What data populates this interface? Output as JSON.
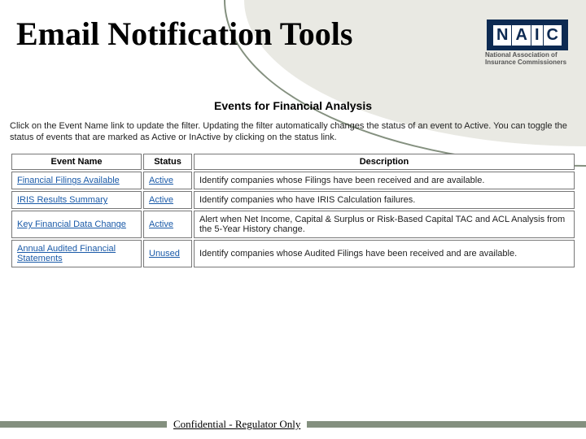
{
  "title": "Email Notification Tools",
  "logo": {
    "letters": [
      "N",
      "A",
      "I",
      "C"
    ],
    "sub1": "National Association of",
    "sub2": "Insurance Commissioners"
  },
  "events": {
    "heading": "Events for Financial Analysis",
    "intro": "Click on the Event Name link to update the filter. Updating the filter automatically changes the status of an event to Active. You can toggle the status of events that are marked as Active or InActive by clicking on the status link.",
    "columns": {
      "name": "Event Name",
      "status": "Status",
      "desc": "Description"
    },
    "rows": [
      {
        "name": "Financial Filings Available",
        "status": "Active",
        "desc": "Identify companies whose Filings have been received and are available."
      },
      {
        "name": "IRIS Results Summary",
        "status": "Active",
        "desc": "Identify companies who have IRIS Calculation failures."
      },
      {
        "name": "Key Financial Data Change",
        "status": "Active",
        "desc": "Alert when Net Income, Capital & Surplus or Risk-Based Capital TAC and ACL Analysis from the 5-Year History change."
      },
      {
        "name": "Annual Audited Financial Statements",
        "status": "Unused",
        "desc": "Identify companies whose Audited Filings have been received and are available."
      }
    ]
  },
  "footer": "Confidential - Regulator Only"
}
